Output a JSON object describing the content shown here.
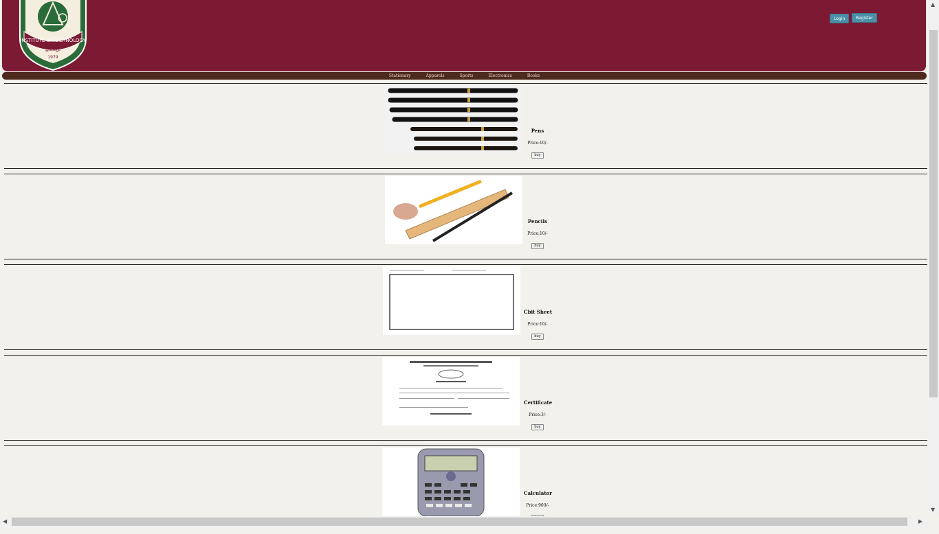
{
  "header": {
    "logo_text": "INSTITUTE of TECHNOLOGY",
    "logo_year": "1979",
    "login_label": "Login",
    "register_label": "Register"
  },
  "nav": {
    "items": [
      "Stationary",
      "Apparels",
      "Sports",
      "Electronics",
      "Books"
    ]
  },
  "products": [
    {
      "name": "Pens",
      "price": "Price:10/-",
      "buy": "buy"
    },
    {
      "name": "Pencils",
      "price": "Price:10/-",
      "buy": "buy"
    },
    {
      "name": "Cbit Sheet",
      "price": "Price:10/-",
      "buy": "buy"
    },
    {
      "name": "Certificate",
      "price": "Price:3/-",
      "buy": "buy"
    },
    {
      "name": "Calculator",
      "price": "Price:900/-",
      "buy": "buy"
    }
  ],
  "colors": {
    "header": "#7c1a34",
    "nav": "#4e2a1e",
    "button": "#4a90a8",
    "page": "#f3f1ec"
  }
}
